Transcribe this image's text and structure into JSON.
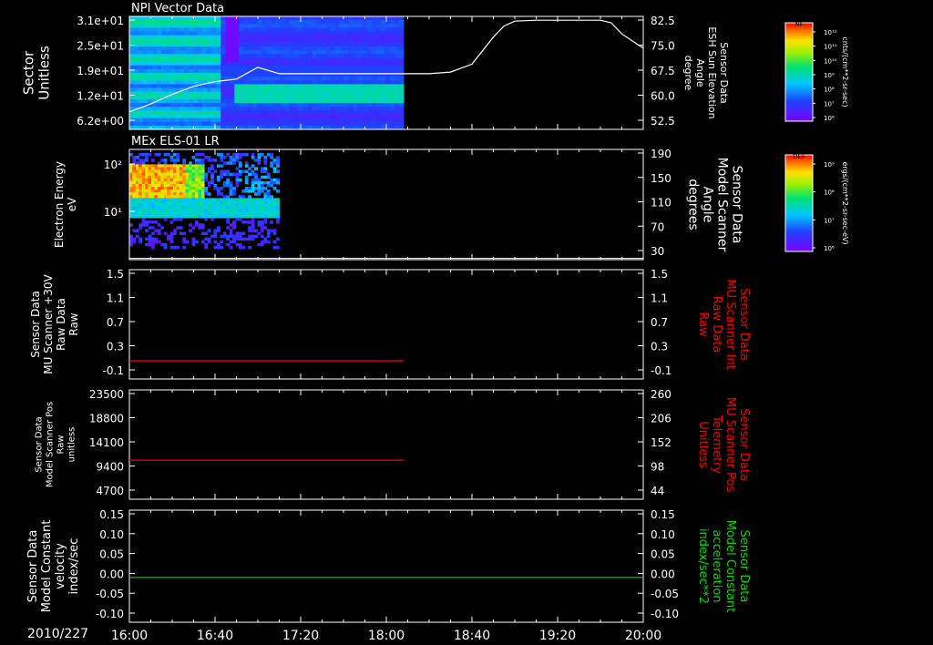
{
  "date_label": "2010/227",
  "time_ticks": [
    "16:00",
    "16:40",
    "17:20",
    "18:00",
    "18:40",
    "19:20",
    "20:00"
  ],
  "colors": {
    "background": "#000000",
    "axis": "#ffffff",
    "red_trace": "#ff0000",
    "green_trace": "#00dd00",
    "gap_fill": "#000000"
  },
  "chart_data": [
    {
      "type": "heatmap",
      "title": "NPI Vector Data",
      "ylabel": [
        "Sector",
        "Unitless"
      ],
      "y_ticks": [
        "3.1e+01",
        "2.5e+01",
        "1.9e+01",
        "1.2e+01",
        "6.2e+00"
      ],
      "right_ylabel": [
        "Sensor Data",
        "ESH Sun Elevation",
        "Angle",
        "degree"
      ],
      "right_ticks": [
        "82.5",
        "75.0",
        "67.5",
        "60.0",
        "52.5"
      ],
      "right_ylim": [
        47,
        82.5
      ],
      "colorbar": {
        "label": "NF",
        "ticks": [
          "10¹²",
          "10¹¹",
          "10¹⁰",
          "10⁹",
          "10⁸",
          "10⁷",
          "10⁶"
        ],
        "units": "cnts/(cm**2-sr-sec)"
      },
      "data_span": [
        "16:00",
        "18:08"
      ],
      "overlay_line": {
        "name": "ESH Sun Elevation Angle",
        "x": [
          "16:00",
          "16:10",
          "16:20",
          "16:30",
          "16:40",
          "16:50",
          "17:00",
          "17:10",
          "17:20",
          "17:30",
          "17:40",
          "17:50",
          "18:00",
          "18:10",
          "18:20",
          "18:30",
          "18:40",
          "18:50",
          "18:55",
          "19:00",
          "19:10",
          "19:20",
          "19:30",
          "19:40",
          "19:45",
          "19:50",
          "20:00"
        ],
        "y": [
          52.5,
          55,
          58,
          60.5,
          62,
          62.8,
          66.5,
          64.5,
          64.5,
          64.5,
          64.5,
          64.5,
          64.5,
          64.5,
          64.5,
          65,
          67.5,
          76,
          79.5,
          81,
          81.3,
          81.3,
          81.3,
          81.3,
          80.5,
          77,
          72.5
        ]
      }
    },
    {
      "type": "heatmap",
      "title": "MEx ELS-01 LR",
      "ylabel": [
        "Electron Energy",
        "eV"
      ],
      "y_ticks": [
        "10²",
        "10¹"
      ],
      "right_ylabel": [
        "Sensor Data",
        "Model Scanner",
        "Angle",
        "degrees"
      ],
      "right_ticks": [
        "190",
        "150",
        "110",
        "70",
        "30"
      ],
      "right_ylim": [
        10,
        190
      ],
      "colorbar": {
        "label": "DEF",
        "ticks": [
          "10⁹",
          "10⁸",
          "10⁷",
          "10⁶"
        ],
        "units": "ergs/(cm**2-sr-sec-eV)"
      },
      "data_span": [
        "16:00",
        "17:10"
      ],
      "overlay_line": {
        "name": "Model Scanner Angle",
        "x": [
          "16:00",
          "20:00"
        ],
        "y": [
          12,
          12
        ]
      }
    },
    {
      "type": "line",
      "ylabel": [
        "Sensor Data",
        "MU Scanner +30V",
        "Raw Data",
        "Raw"
      ],
      "y_ticks": [
        "1.5",
        "1.1",
        "0.7",
        "0.3",
        "-0.1"
      ],
      "ylim": [
        -0.3,
        1.5
      ],
      "right_ylabel": [
        "Sensor Data",
        "MU Scanner Int",
        "Raw Data",
        "Raw"
      ],
      "right_ticks": [
        "1.5",
        "1.1",
        "0.7",
        "0.3",
        "-0.1"
      ],
      "series": [
        {
          "x": [
            "16:00",
            "18:08"
          ],
          "y": [
            0.0,
            0.0
          ]
        }
      ]
    },
    {
      "type": "line",
      "ylabel": [
        "Sensor Data",
        "Model Scanner Pos",
        "Raw",
        "unitless"
      ],
      "y_ticks": [
        "23500",
        "18800",
        "14100",
        "9400",
        "4700"
      ],
      "ylim": [
        0,
        23500
      ],
      "right_ylabel": [
        "Sensor Data",
        "MU Scanner Pos",
        "Telemetry",
        "Unitless"
      ],
      "right_ticks": [
        "260",
        "206",
        "152",
        "98",
        "44"
      ],
      "series": [
        {
          "x": [
            "16:00",
            "18:08"
          ],
          "y": [
            8400,
            8400
          ]
        }
      ]
    },
    {
      "type": "line",
      "ylabel": [
        "Sensor Data",
        "Model Constant",
        "velocity",
        "index/sec"
      ],
      "y_ticks": [
        "0.15",
        "0.10",
        "0.05",
        "0.00",
        "-0.05",
        "-0.10"
      ],
      "ylim": [
        -0.1,
        0.15
      ],
      "right_ylabel": [
        "Sensor Data",
        "Model Constant",
        "acceleration",
        "index/sec**2"
      ],
      "right_ticks": [
        "0.15",
        "0.10",
        "0.05",
        "0.00",
        "-0.05",
        "-0.10"
      ],
      "series": [
        {
          "x": [
            "16:00",
            "20:00"
          ],
          "y": [
            0.0,
            0.0
          ]
        }
      ]
    }
  ]
}
